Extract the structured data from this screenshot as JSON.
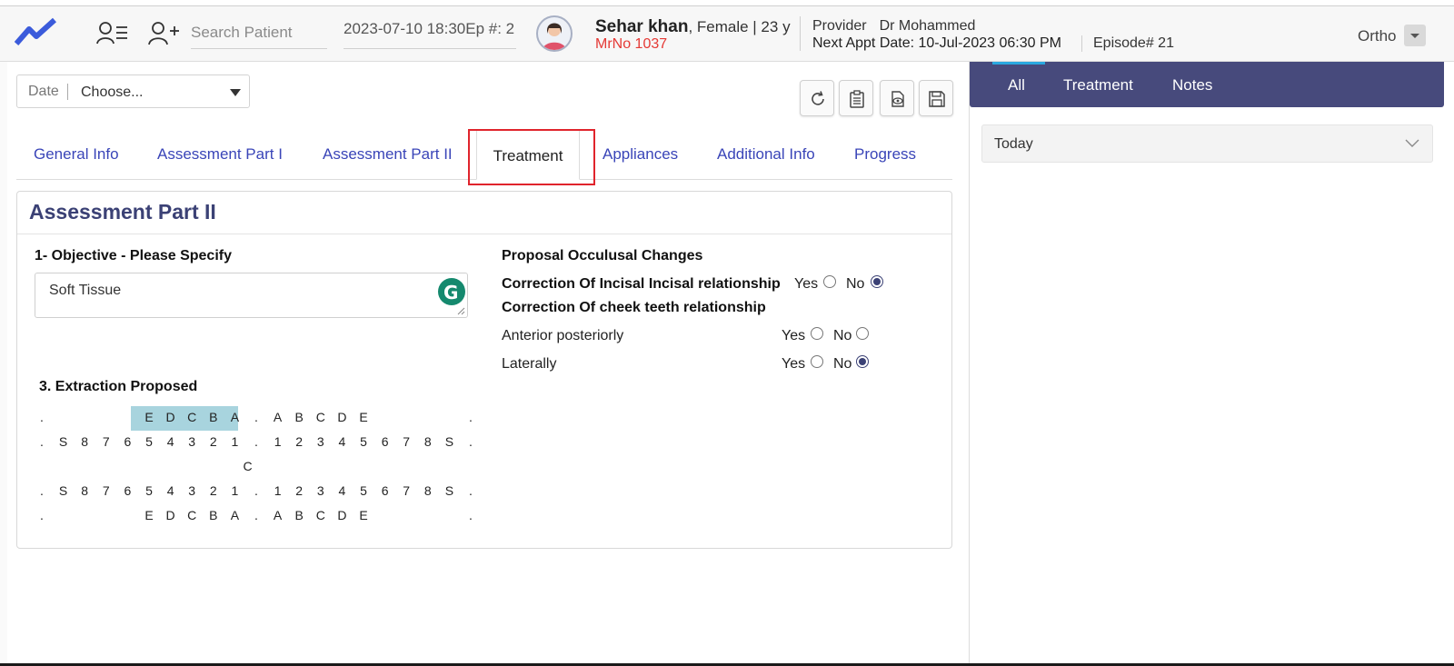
{
  "header": {
    "search_placeholder": "Search Patient",
    "episode_select": "2023-07-10 18:30Ep #: 2",
    "patient": {
      "name": "Sehar khan",
      "demographics": ", Female | 23 y",
      "mrno": "MrNo 1037"
    },
    "provider_label": "Provider",
    "provider_name": "Dr Mohammed",
    "next_appt": "Next Appt Date: 10-Jul-2023 06:30 PM",
    "episode_no": "Episode# 21",
    "specialty": "Ortho"
  },
  "filter": {
    "date_label": "Date",
    "date_value": "Choose..."
  },
  "tabs": [
    "General Info",
    "Assessment Part I",
    "Assessment Part II",
    "Treatment",
    "Appliances",
    "Additional Info",
    "Progress"
  ],
  "card": {
    "title": "Assessment Part II",
    "objective_label": "1- Objective - Please Specify",
    "objective_value": "Soft Tissue",
    "proposal_heading": "Proposal Occulusal Changes",
    "incisal_label": "Correction Of Incisal Incisal relationship",
    "cheek_label": "Correction Of cheek teeth relationship",
    "anterior_label": "Anterior posteriorly",
    "laterally_label": "Laterally",
    "yes": "Yes",
    "no": "No",
    "extraction_label": "3. Extraction Proposed"
  },
  "radio_state": {
    "incisal": "no",
    "anterior": "none",
    "laterally": "no"
  },
  "tooth_chart": {
    "row1": [
      ".",
      "",
      "",
      "",
      "E",
      "D",
      "C",
      "B",
      "A",
      ".",
      "A",
      "B",
      "C",
      "D",
      "E",
      "",
      "",
      "",
      "."
    ],
    "row2": [
      ".",
      "S",
      "8",
      "7",
      "6",
      "5",
      "4",
      "3",
      "2",
      "1",
      ".",
      "1",
      "2",
      "3",
      "4",
      "5",
      "6",
      "7",
      "8",
      "S",
      "."
    ],
    "mid": "C",
    "row3": [
      ".",
      "S",
      "8",
      "7",
      "6",
      "5",
      "4",
      "3",
      "2",
      "1",
      ".",
      "1",
      "2",
      "3",
      "4",
      "5",
      "6",
      "7",
      "8",
      "S",
      "."
    ],
    "row4": [
      ".",
      "",
      "",
      "",
      "E",
      "D",
      "C",
      "B",
      "A",
      ".",
      "A",
      "B",
      "C",
      "D",
      "E",
      "",
      "",
      "",
      "."
    ]
  },
  "right_panel": {
    "tabs": [
      "All",
      "Treatment",
      "Notes"
    ],
    "group_label": "Today"
  },
  "colors": {
    "accent_navy": "#3b4175",
    "tab_link": "#3a45b8",
    "highlight_red": "#e0242c",
    "mrno_red": "#e53935",
    "tooth_highlight": "#a8d4de",
    "right_tab_indicator": "#2aa8e0"
  }
}
